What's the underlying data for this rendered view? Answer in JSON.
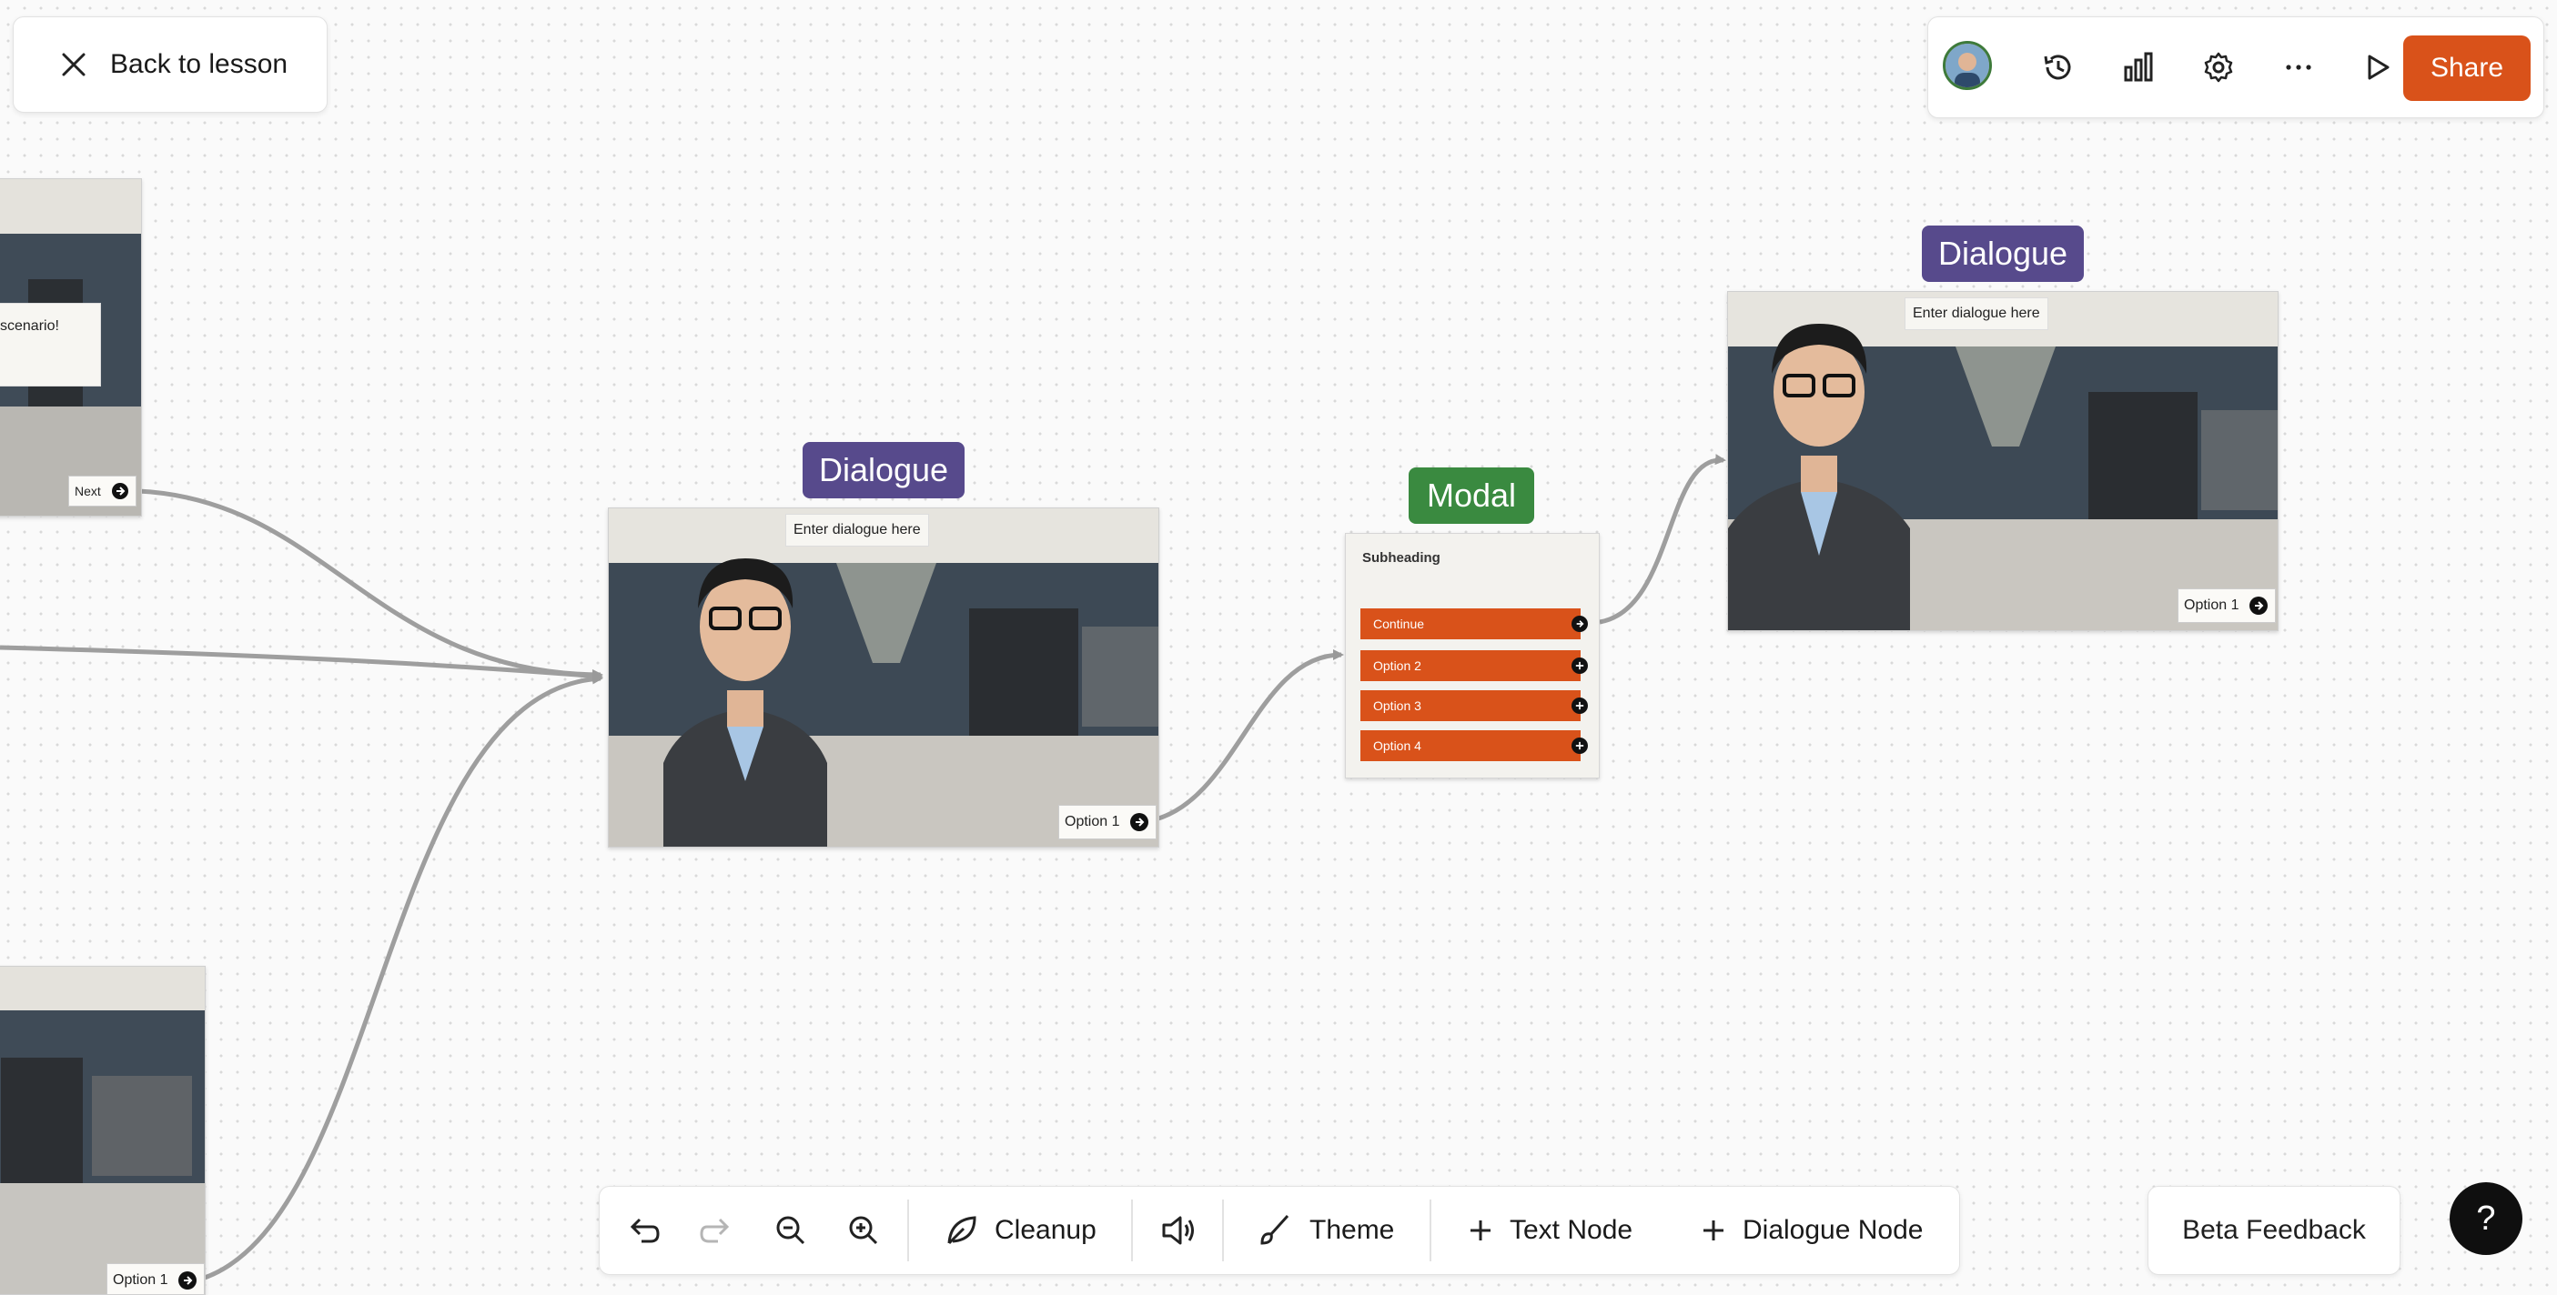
{
  "back_button": {
    "label": "Back to lesson"
  },
  "topbar": {
    "avatar_icon": "user-avatar",
    "icons": [
      "history-icon",
      "analytics-icon",
      "settings-icon",
      "more-icon",
      "play-icon"
    ],
    "share_label": "Share",
    "accent": "#d9521a"
  },
  "nodes": {
    "left_top": {
      "dialogue_fragment": "scenario!",
      "option_label": "Next"
    },
    "left_bottom": {
      "option_label": "Option 1"
    },
    "dialogue_center": {
      "tag": "Dialogue",
      "dialogue_placeholder": "Enter dialogue here",
      "option_label": "Option 1"
    },
    "modal": {
      "tag": "Modal",
      "subheading": "Subheading",
      "buttons": [
        "Continue",
        "Option 2",
        "Option 3",
        "Option 4"
      ]
    },
    "dialogue_right": {
      "tag": "Dialogue",
      "dialogue_placeholder": "Enter dialogue here",
      "option_label": "Option 1"
    }
  },
  "colors": {
    "dialogue_tag": "#574a8c",
    "modal_tag": "#3a8a40",
    "modal_button": "#d9521a"
  },
  "bottombar": {
    "undo_icon": "undo-icon",
    "redo_icon": "redo-icon",
    "zoom_out_icon": "zoom-out-icon",
    "zoom_in_icon": "zoom-in-icon",
    "cleanup_label": "Cleanup",
    "audio_icon": "speaker-icon",
    "theme_label": "Theme",
    "text_node_label": "Text Node",
    "dialogue_node_label": "Dialogue Node"
  },
  "beta_feedback_label": "Beta Feedback",
  "help_label": "?"
}
